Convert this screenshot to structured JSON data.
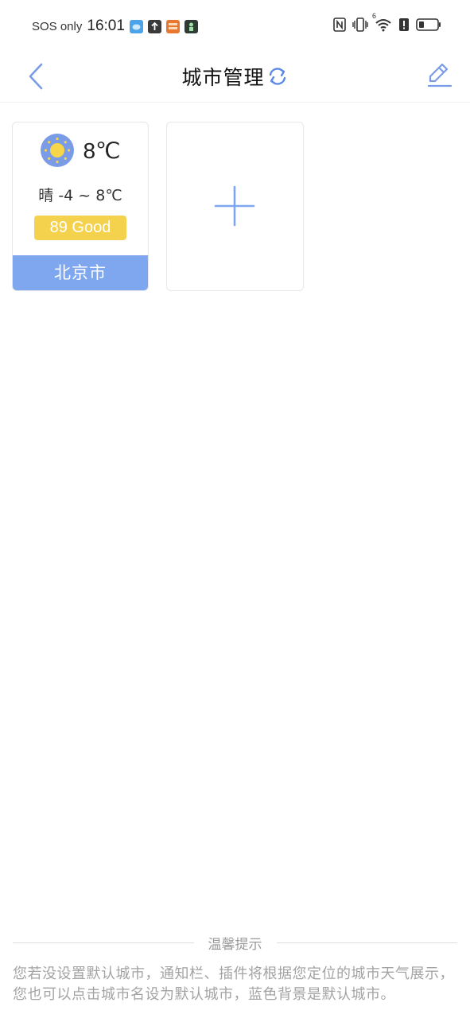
{
  "status_bar": {
    "carrier": "SOS only",
    "time": "16:01",
    "notification_icons": [
      "cloud-app-icon",
      "upload-icon",
      "reader-app-icon",
      "game-app-icon"
    ],
    "system_icons": [
      "nfc-icon",
      "vibrate-icon",
      "wifi-icon",
      "alert-icon",
      "battery-icon"
    ],
    "wifi_badge": "6"
  },
  "header": {
    "title": "城市管理",
    "back_icon": "chevron-left-icon",
    "refresh_icon": "refresh-icon",
    "edit_icon": "edit-icon"
  },
  "cities": [
    {
      "name": "北京市",
      "current_temp": "8℃",
      "weather_icon": "sunny-icon",
      "description": "晴 -4 ~ 8℃",
      "aqi_label": "89 Good",
      "is_default": true
    }
  ],
  "add_city": {
    "icon": "plus-icon"
  },
  "tips": {
    "title": "温馨提示",
    "text": "您若没设置默认城市，通知栏、插件将根据您定位的城市天气展示，您也可以点击城市名设为默认城市，蓝色背景是默认城市。"
  },
  "colors": {
    "accent": "#7fa7ef",
    "aqi_good": "#f4d24e",
    "sun": "#f7d64a",
    "icon_blue": "#7a9be6",
    "tips_text": "#a3a3a3"
  }
}
